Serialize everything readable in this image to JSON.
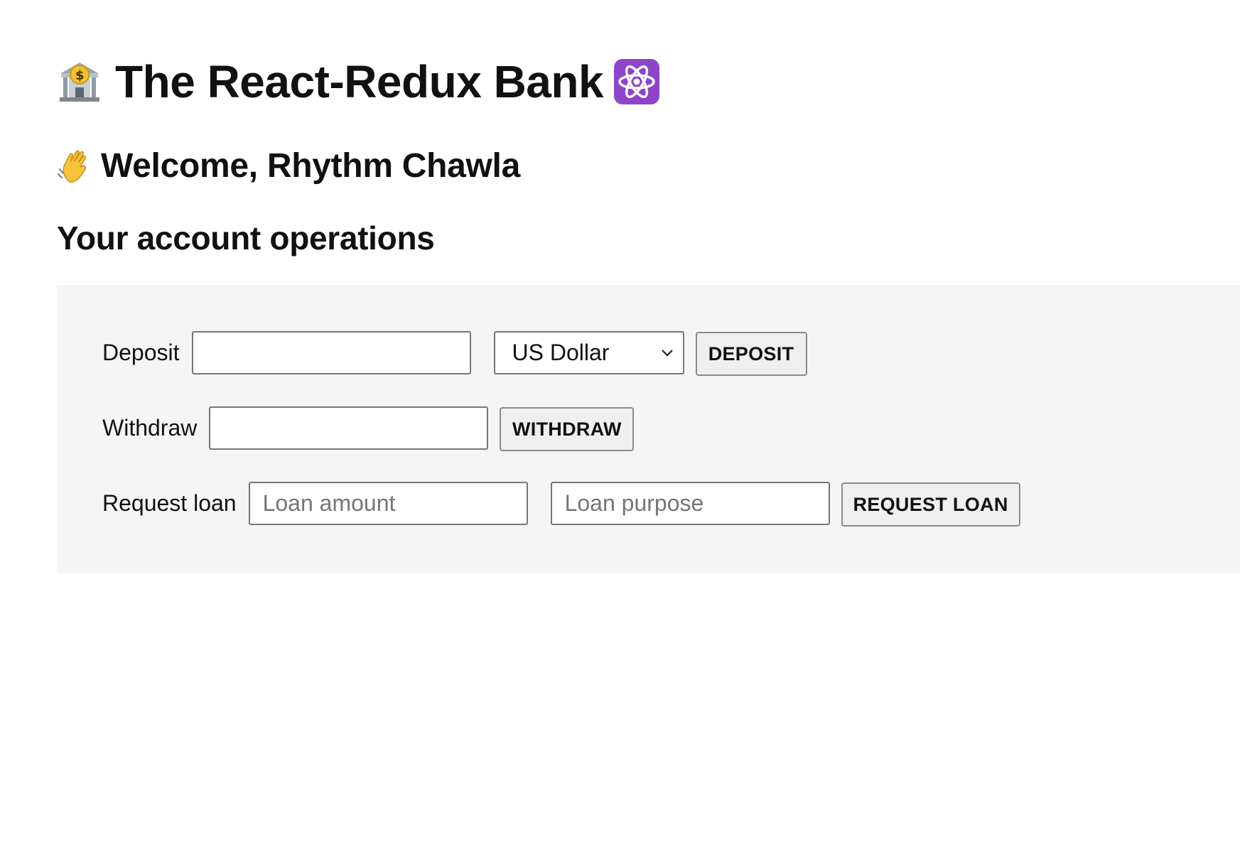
{
  "header": {
    "title_text": "The React-Redux Bank",
    "title_icon_left": "bank-icon",
    "title_icon_right": "atom-icon",
    "welcome_text": "Welcome, Rhythm Chawla",
    "welcome_icon": "waving-hand-icon"
  },
  "operations": {
    "title": "Your account operations",
    "deposit": {
      "label": "Deposit",
      "amount_value": "",
      "currency_selected": "US Dollar",
      "button_label": "DEPOSIT"
    },
    "withdraw": {
      "label": "Withdraw",
      "amount_value": "",
      "button_label": "WITHDRAW"
    },
    "loan": {
      "label": "Request loan",
      "amount_placeholder": "Loan amount",
      "purpose_placeholder": "Loan purpose",
      "button_label": "REQUEST LOAN"
    }
  },
  "colors": {
    "panel_background": "#f5f5f5",
    "button_background": "#efefef",
    "atom_tile": "#8e44c9",
    "bank_coin": "#f2c230"
  }
}
